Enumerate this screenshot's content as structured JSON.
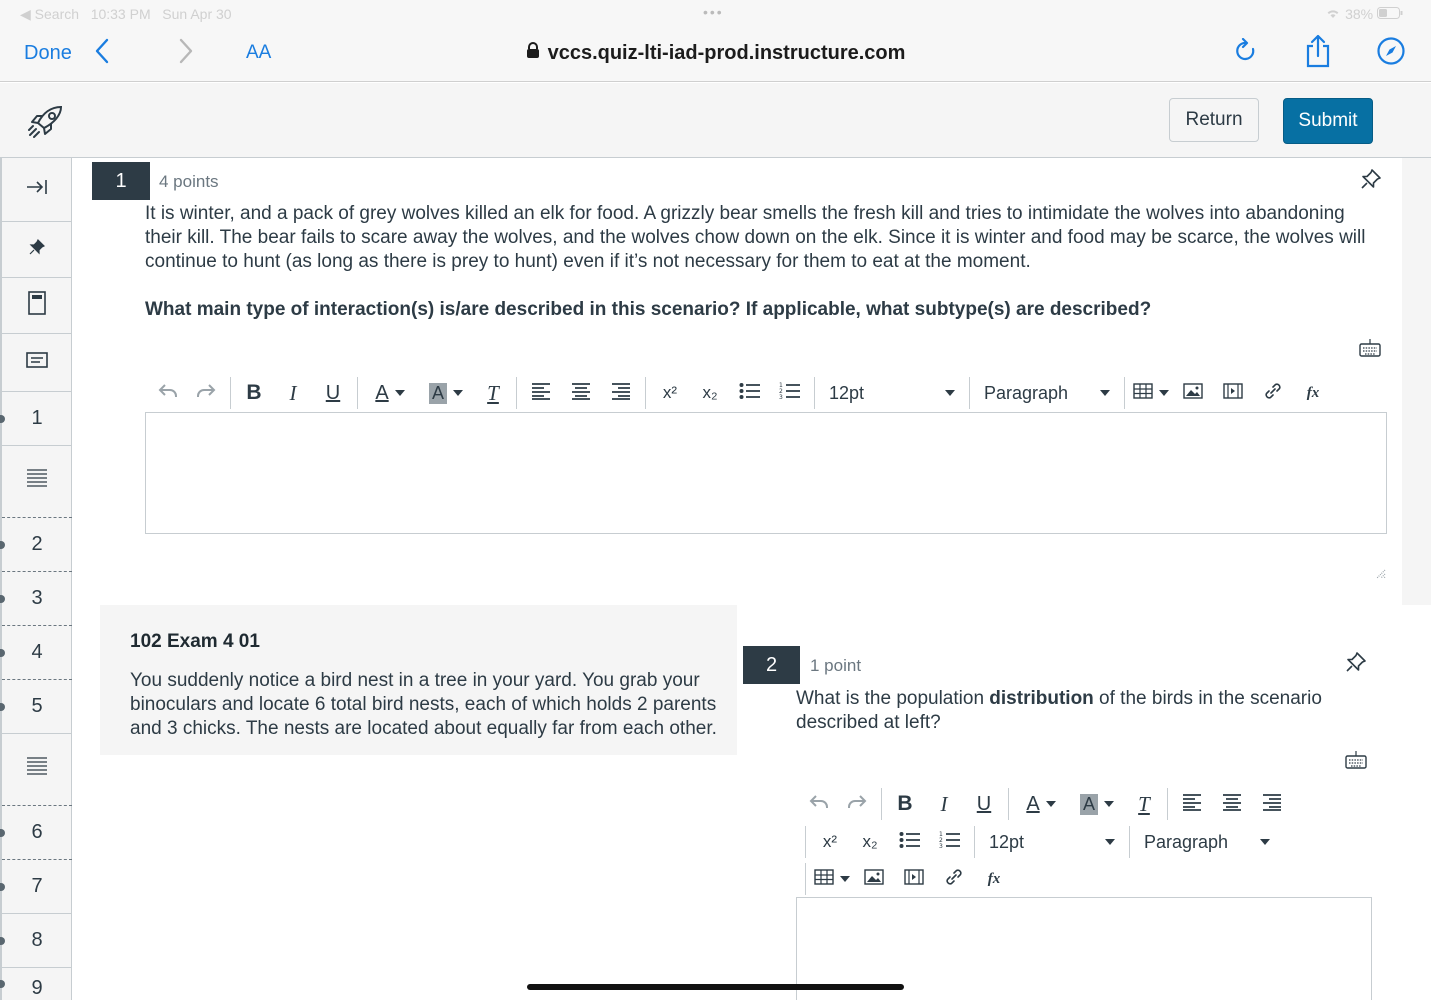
{
  "status_bar": {
    "back_app": "◀ Search",
    "time": "10:33 PM",
    "date": "Sun Apr 30",
    "dots": "•••",
    "battery": "38%"
  },
  "browser": {
    "done_label": "Done",
    "aa_label": "AA",
    "url": "vccs.quiz-lti-iad-prod.instructure.com"
  },
  "header": {
    "return_label": "Return",
    "submit_label": "Submit"
  },
  "rail": {
    "numbers": [
      "1",
      "2",
      "3",
      "4",
      "5",
      "6",
      "7",
      "8",
      "9"
    ]
  },
  "question1": {
    "number": "1",
    "points": "4 points",
    "body": "It is winter, and a pack of grey wolves killed an elk for food. A grizzly bear smells the fresh kill and tries to intimidate the wolves into abandoning their kill. The bear fails to scare away the wolves, and the wolves chow down on the elk. Since it is winter and food may be scarce, the wolves will continue to hunt (as long as there is prey to hunt) even if it’s not necessary for them to eat at the moment.",
    "prompt": "What main type of interaction(s) is/are described in this scenario? If applicable, what subtype(s) are described?"
  },
  "editor": {
    "font_size": "12pt",
    "block_format": "Paragraph",
    "bold": "B",
    "italic": "I",
    "underline": "U",
    "text_color": "A",
    "bg_color": "A",
    "clear_format": "T",
    "superscript": "x²",
    "subscript": "x₂",
    "formula": "fx"
  },
  "stimulus": {
    "title": "102 Exam 4 01",
    "body": "You suddenly notice a bird nest in a tree in your yard. You grab your binoculars and locate 6 total bird nests, each of which holds 2 parents and 3 chicks. The nests are located about equally far from each other."
  },
  "question2": {
    "number": "2",
    "points": "1 point",
    "text_before": "What is the population ",
    "text_bold": "distribution",
    "text_after": " of the birds in the scenario described at left?"
  },
  "colors": {
    "primary_button": "#0770a3",
    "dark_badge": "#2d3b45",
    "ios_blue": "#1a7de0"
  }
}
